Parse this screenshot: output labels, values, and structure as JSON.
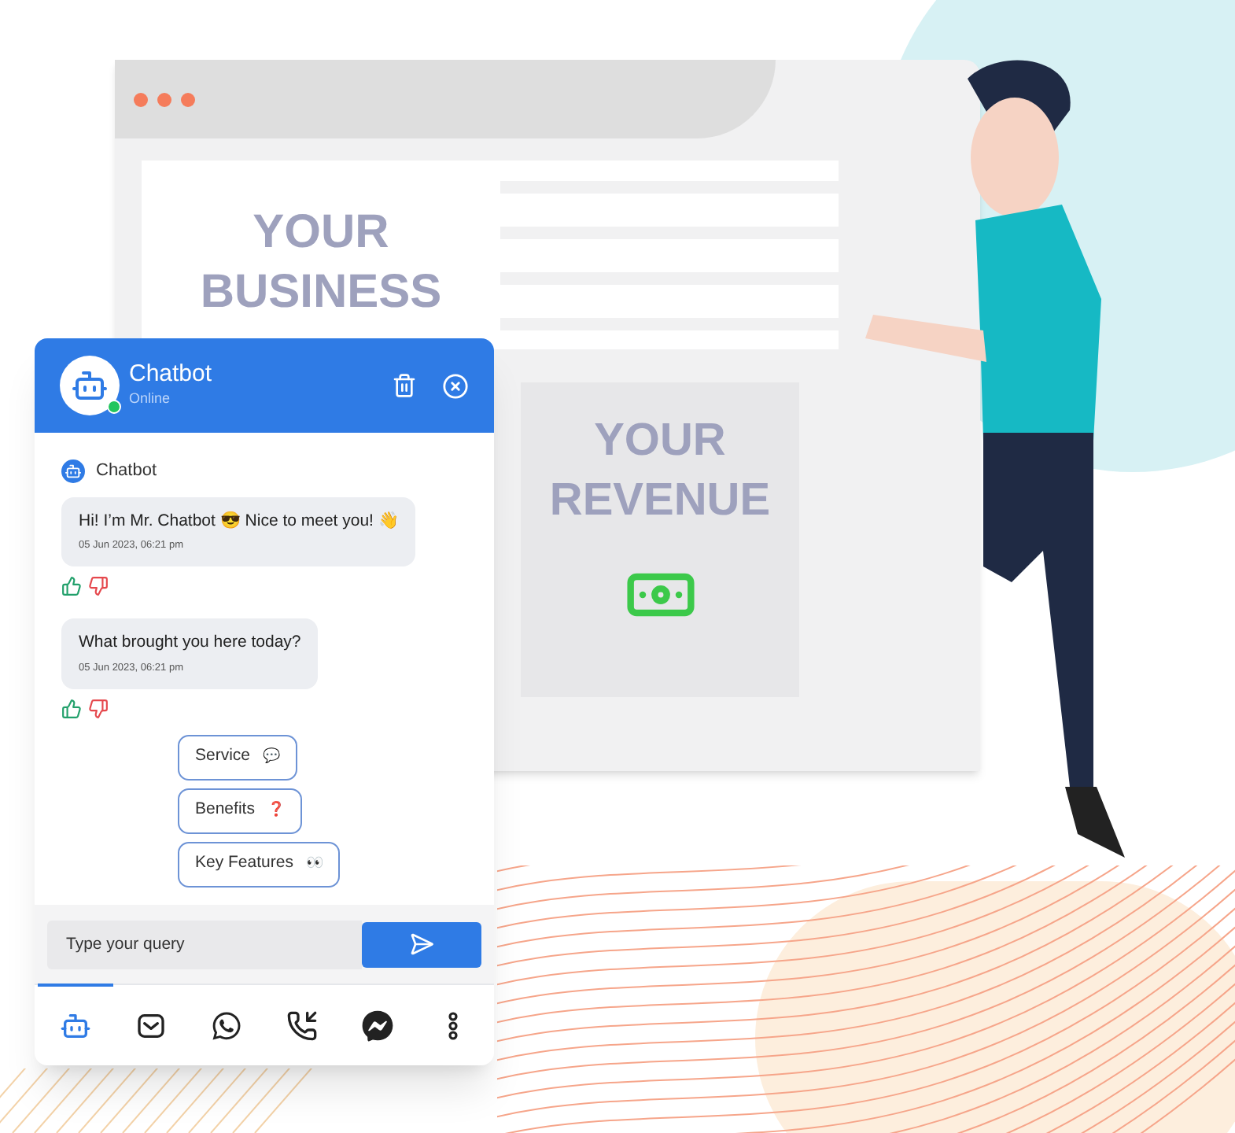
{
  "browser": {
    "headline": [
      "YOUR",
      "BUSINESS"
    ],
    "revenue": [
      "YOUR",
      "REVENUE"
    ]
  },
  "chat": {
    "title": "Chatbot",
    "status": "Online",
    "online": true,
    "sender": "Chatbot",
    "messages": [
      {
        "text": "Hi! I’m Mr. Chatbot 😎 Nice to meet you! 👋",
        "time": "05 Jun 2023, 06:21 pm"
      },
      {
        "text": "What brought you here today?",
        "time": "05 Jun 2023, 06:21 pm"
      }
    ],
    "options": [
      {
        "label": "Service",
        "emoji": "💬"
      },
      {
        "label": "Benefits",
        "emoji": "❓"
      },
      {
        "label": "Key Features",
        "emoji": "👀"
      }
    ],
    "input": {
      "placeholder": "Type your query"
    },
    "channels": [
      {
        "kind": "bot",
        "selected": true
      },
      {
        "kind": "mail",
        "selected": false
      },
      {
        "kind": "whatsapp",
        "selected": false
      },
      {
        "kind": "call",
        "selected": false
      },
      {
        "kind": "messenger",
        "selected": false
      },
      {
        "kind": "more",
        "selected": false
      }
    ]
  }
}
